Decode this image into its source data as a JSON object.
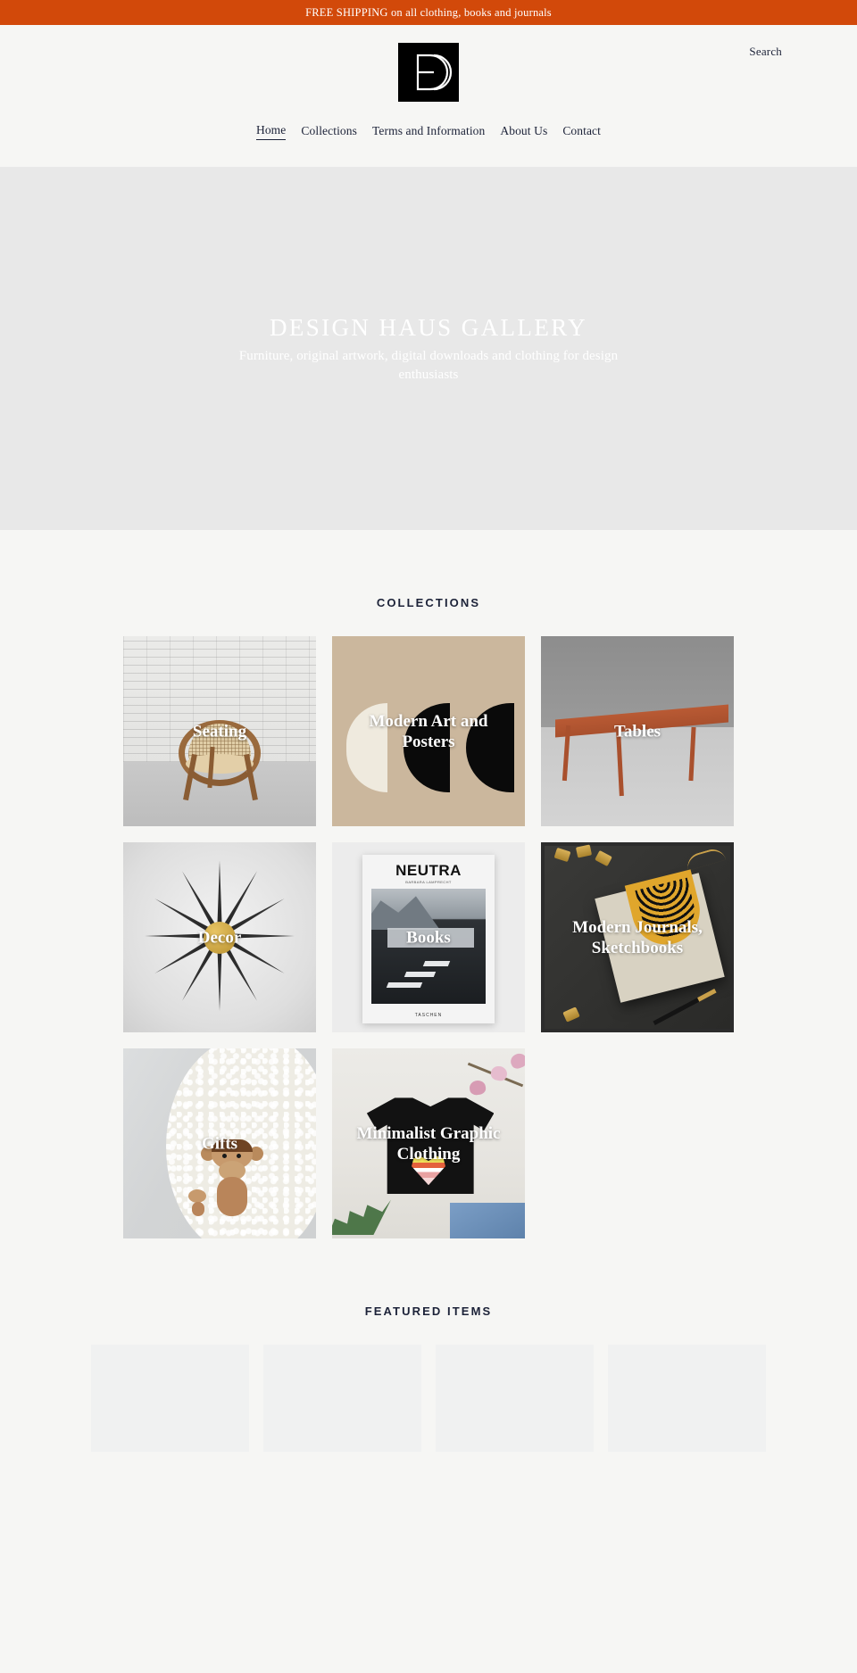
{
  "announcement": {
    "text": "FREE SHIPPING on all clothing, books and journals",
    "background": "#d2490a",
    "color": "#ffffff"
  },
  "header": {
    "logo_alt": "Design Haus Gallery",
    "search_label": "Search",
    "nav": [
      {
        "label": "Home",
        "active": true
      },
      {
        "label": "Collections",
        "active": false
      },
      {
        "label": "Terms and Information",
        "active": false
      },
      {
        "label": "About Us",
        "active": false
      },
      {
        "label": "Contact",
        "active": false
      }
    ]
  },
  "hero": {
    "title": "DESIGN HAUS GALLERY",
    "subtitle": "Furniture, original artwork, digital downloads and clothing for design enthusiasts",
    "background": "#e8e8e8",
    "text_color": "#ffffff"
  },
  "collections": {
    "heading": "COLLECTIONS",
    "items": [
      {
        "title": "Seating"
      },
      {
        "title": "Modern Art and Posters"
      },
      {
        "title": "Tables"
      },
      {
        "title": "Decor"
      },
      {
        "title": "Books"
      },
      {
        "title": "Modern Journals, Sketchbooks"
      },
      {
        "title": "Gifts"
      },
      {
        "title": "Minimalist Graphic Clothing"
      }
    ]
  },
  "book_cover": {
    "title": "NEUTRA",
    "subtitle": "BARBARA LAMPRECHT",
    "publisher": "TASCHEN"
  },
  "featured": {
    "heading": "FEATURED ITEMS",
    "placeholder_count": 4
  },
  "theme": {
    "page_background": "#f6f6f4",
    "accent": "#d2490a",
    "text": "#1c2238"
  }
}
